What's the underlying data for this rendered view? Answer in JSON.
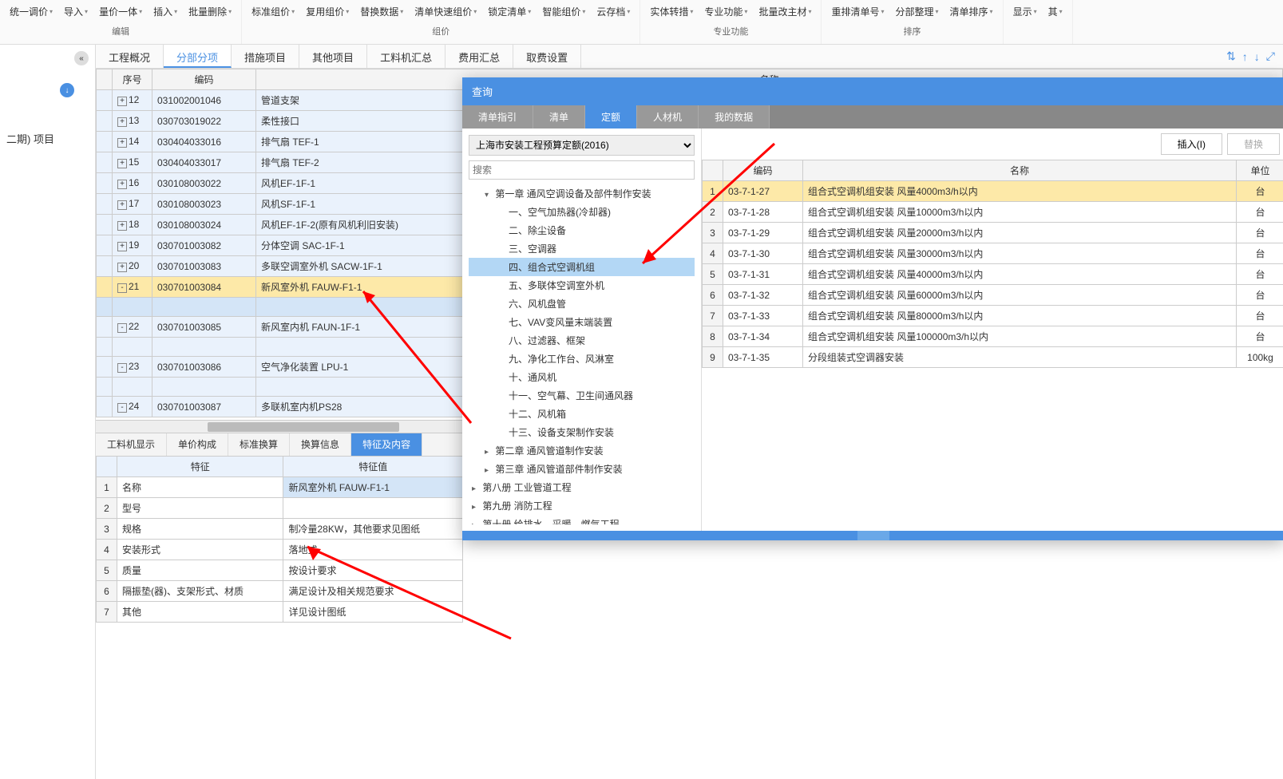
{
  "toolbar": {
    "groups": [
      {
        "label": "编辑",
        "items": [
          "统一调价",
          "导入",
          "量价一体",
          "插入",
          "批量删除"
        ]
      },
      {
        "label": "组价",
        "items": [
          "标准组价",
          "复用组价",
          "替换数据",
          "清单快速组价",
          "锁定清单",
          "智能组价",
          "云存档"
        ]
      },
      {
        "label": "专业功能",
        "items": [
          "实体转措",
          "专业功能",
          "批量改主材"
        ]
      },
      {
        "label": "排序",
        "items": [
          "重排清单号",
          "分部整理",
          "清单排序"
        ]
      },
      {
        "label": "",
        "items": [
          "显示",
          "其"
        ]
      }
    ]
  },
  "left_panel": {
    "project": "二期) 项目"
  },
  "tabs": [
    "工程概况",
    "分部分项",
    "措施项目",
    "其他项目",
    "工料机汇总",
    "费用汇总",
    "取费设置"
  ],
  "active_tab": 1,
  "main_table": {
    "headers": [
      "",
      "序号",
      "编码",
      "名称"
    ],
    "rows": [
      {
        "marker": "+",
        "seq": "12",
        "code": "031002001046",
        "name": "管道支架",
        "cls": "sub-row"
      },
      {
        "marker": "+",
        "seq": "13",
        "code": "030703019022",
        "name": "柔性接口",
        "cls": "sub-row"
      },
      {
        "marker": "+",
        "seq": "14",
        "code": "030404033016",
        "name": "排气扇 TEF-1",
        "cls": "sub-row"
      },
      {
        "marker": "+",
        "seq": "15",
        "code": "030404033017",
        "name": "排气扇 TEF-2",
        "cls": "sub-row"
      },
      {
        "marker": "+",
        "seq": "16",
        "code": "030108003022",
        "name": "风机EF-1F-1",
        "cls": "sub-row"
      },
      {
        "marker": "+",
        "seq": "17",
        "code": "030108003023",
        "name": "风机SF-1F-1",
        "cls": "sub-row"
      },
      {
        "marker": "+",
        "seq": "18",
        "code": "030108003024",
        "name": "风机EF-1F-2(原有风机利旧安装)",
        "cls": "sub-row"
      },
      {
        "marker": "+",
        "seq": "19",
        "code": "030701003082",
        "name": "分体空调 SAC-1F-1",
        "cls": "sub-row"
      },
      {
        "marker": "+",
        "seq": "20",
        "code": "030701003083",
        "name": "多联空调室外机 SACW-1F-1",
        "cls": "sub-row"
      },
      {
        "marker": "-",
        "seq": "21",
        "code": "030701003084",
        "name": "新风室外机 FAUW-F1-1",
        "cls": "highlighted"
      },
      {
        "marker": "",
        "seq": "",
        "code": "",
        "name": "",
        "cls": "selected-row"
      },
      {
        "marker": "-",
        "seq": "22",
        "code": "030701003085",
        "name": "新风室内机 FAUN-1F-1",
        "cls": "sub-row"
      },
      {
        "marker": "",
        "seq": "",
        "code": "",
        "name": "",
        "cls": "sub-row"
      },
      {
        "marker": "-",
        "seq": "23",
        "code": "030701003086",
        "name": "空气净化装置 LPU-1",
        "cls": "sub-row"
      },
      {
        "marker": "",
        "seq": "",
        "code": "",
        "name": "",
        "cls": "sub-row"
      },
      {
        "marker": "-",
        "seq": "24",
        "code": "030701003087",
        "name": "多联机室内机PS28",
        "cls": "sub-row"
      }
    ]
  },
  "bottom_tabs": [
    "工料机显示",
    "单价构成",
    "标准换算",
    "换算信息",
    "特征及内容"
  ],
  "active_bottom_tab": 4,
  "feature_table": {
    "headers": [
      "",
      "特征",
      "特征值"
    ],
    "rows": [
      {
        "idx": "1",
        "feat": "名称",
        "val": "新风室外机 FAUW-F1-1",
        "sel": true
      },
      {
        "idx": "2",
        "feat": "型号",
        "val": ""
      },
      {
        "idx": "3",
        "feat": "规格",
        "val": "制冷量28KW，其他要求见图纸"
      },
      {
        "idx": "4",
        "feat": "安装形式",
        "val": "落地式"
      },
      {
        "idx": "5",
        "feat": "质量",
        "val": "按设计要求"
      },
      {
        "idx": "6",
        "feat": "隔振垫(器)、支架形式、材质",
        "val": "满足设计及相关规范要求"
      },
      {
        "idx": "7",
        "feat": "其他",
        "val": "详见设计图纸"
      }
    ]
  },
  "dialog": {
    "title": "查询",
    "tabs": [
      "清单指引",
      "清单",
      "定额",
      "人材机",
      "我的数据"
    ],
    "active_tab": 2,
    "insert_btn": "插入(I)",
    "replace_btn": "替换",
    "select_value": "上海市安装工程预算定额(2016)",
    "search_placeholder": "搜索",
    "tree": [
      {
        "text": "第一章 通风空调设备及部件制作安装",
        "indent": 1,
        "toggle": "▾"
      },
      {
        "text": "一、空气加热器(冷却器)",
        "indent": 2
      },
      {
        "text": "二、除尘设备",
        "indent": 2
      },
      {
        "text": "三、空调器",
        "indent": 2
      },
      {
        "text": "四、组合式空调机组",
        "indent": 2,
        "selected": true
      },
      {
        "text": "五、多联体空调室外机",
        "indent": 2
      },
      {
        "text": "六、风机盘管",
        "indent": 2
      },
      {
        "text": "七、VAV变风量末端装置",
        "indent": 2
      },
      {
        "text": "八、过滤器、框架",
        "indent": 2
      },
      {
        "text": "九、净化工作台、风淋室",
        "indent": 2
      },
      {
        "text": "十、通风机",
        "indent": 2
      },
      {
        "text": "十一、空气幕、卫生间通风器",
        "indent": 2
      },
      {
        "text": "十二、风机箱",
        "indent": 2
      },
      {
        "text": "十三、设备支架制作安装",
        "indent": 2
      },
      {
        "text": "第二章 通风管道制作安装",
        "indent": 1,
        "toggle": "▸"
      },
      {
        "text": "第三章 通风管道部件制作安装",
        "indent": 1,
        "toggle": "▸"
      },
      {
        "text": "第八册 工业管道工程",
        "indent": 0,
        "toggle": "▸"
      },
      {
        "text": "第九册 消防工程",
        "indent": 0,
        "toggle": "▸"
      },
      {
        "text": "第十册 给排水、采暖、燃气工程",
        "indent": 0,
        "toggle": "▸"
      }
    ],
    "result_headers": [
      "",
      "编码",
      "名称",
      "单位"
    ],
    "result_rows": [
      {
        "idx": "1",
        "code": "03-7-1-27",
        "name": "组合式空调机组安装 风量4000m3/h以内",
        "unit": "台",
        "sel": true
      },
      {
        "idx": "2",
        "code": "03-7-1-28",
        "name": "组合式空调机组安装 风量10000m3/h以内",
        "unit": "台"
      },
      {
        "idx": "3",
        "code": "03-7-1-29",
        "name": "组合式空调机组安装 风量20000m3/h以内",
        "unit": "台"
      },
      {
        "idx": "4",
        "code": "03-7-1-30",
        "name": "组合式空调机组安装 风量30000m3/h以内",
        "unit": "台"
      },
      {
        "idx": "5",
        "code": "03-7-1-31",
        "name": "组合式空调机组安装 风量40000m3/h以内",
        "unit": "台"
      },
      {
        "idx": "6",
        "code": "03-7-1-32",
        "name": "组合式空调机组安装 风量60000m3/h以内",
        "unit": "台"
      },
      {
        "idx": "7",
        "code": "03-7-1-33",
        "name": "组合式空调机组安装 风量80000m3/h以内",
        "unit": "台"
      },
      {
        "idx": "8",
        "code": "03-7-1-34",
        "name": "组合式空调机组安装 风量100000m3/h以内",
        "unit": "台"
      },
      {
        "idx": "9",
        "code": "03-7-1-35",
        "name": "分段组装式空调器安装",
        "unit": "100kg"
      }
    ]
  }
}
